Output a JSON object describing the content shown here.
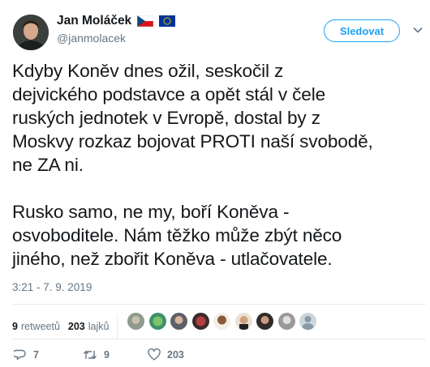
{
  "author": {
    "display_name": "Jan Moláček",
    "handle": "@janmolacek",
    "badges": [
      "czech-flag-icon",
      "eu-flag-icon"
    ]
  },
  "follow_button": {
    "label": "Sledovat"
  },
  "tweet": {
    "paragraphs": [
      [
        "Kdyby Koněv dnes ožil, seskočil z",
        "dejvického podstavce a opět stál v čele",
        "ruských jednotek v Evropě, dostal by z",
        "Moskvy rozkaz bojovat PROTI naší svobodě,",
        "ne ZA ni."
      ],
      [
        "Rusko samo, ne my, boří Koněva -",
        "osvoboditele. Nám těžko může zbýt něco",
        "jiného, než zbořit Koněva - utlačovatele."
      ]
    ],
    "timestamp": "3:21 - 7. 9. 2019"
  },
  "stats": {
    "retweets_count": "9",
    "retweets_label": "retweetů",
    "likes_count": "203",
    "likes_label": "lajků"
  },
  "likers": [
    "liker-avatar",
    "liker-avatar",
    "liker-avatar",
    "liker-avatar",
    "liker-avatar",
    "liker-avatar",
    "liker-avatar",
    "liker-avatar",
    "liker-avatar"
  ],
  "actions": {
    "reply": {
      "icon": "reply-icon",
      "count": "7"
    },
    "retweet": {
      "icon": "retweet-icon",
      "count": "9"
    },
    "like": {
      "icon": "heart-icon",
      "count": "203"
    }
  },
  "colors": {
    "accent": "#1da1f2",
    "muted": "#657786",
    "text": "#14171a",
    "divider": "#e6ecf0"
  }
}
